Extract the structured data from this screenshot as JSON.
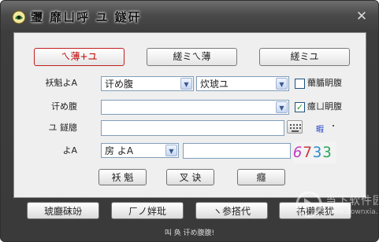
{
  "window": {
    "title": "瓕   靡ㄩ呼   ユ   鐩矸"
  },
  "tabs": [
    {
      "label": "ㄟ薄+ユ",
      "active": true
    },
    {
      "label": "縒ミㄟ薄",
      "active": false
    },
    {
      "label": "縒ミユ",
      "active": false
    }
  ],
  "form": {
    "row1": {
      "label": "袄魁よA",
      "select1": "讦め腹",
      "select2": "炊琥ユ",
      "checkbox_label": "薾腯眀腹",
      "checked": false
    },
    "row2": {
      "label": "讦め腹",
      "select": "",
      "checkbox_label": "癔ㄩ眀腹",
      "checked": true
    },
    "row3": {
      "label": "ユ   鐩牕",
      "value": "",
      "link": "暇"
    },
    "row4": {
      "label": "よA",
      "select": "房   よA",
      "value": "",
      "captcha": [
        "6",
        "7",
        "3",
        "3"
      ]
    }
  },
  "actions": {
    "login": "袄 魁",
    "register": "叉 诀",
    "cancel": "癮"
  },
  "bottom_buttons": [
    "琥廳砞竕",
    "ㄏノ姅玭",
    "ヽ参搭代",
    "祐獭乘犹"
  ],
  "status": "叫 奂    讦め腹腹!",
  "watermark": {
    "text": "当下软件园",
    "url": "www.downxia.com"
  },
  "colors": {
    "accent_red": "#c00000",
    "check_green": "#21a121",
    "link_blue": "#1a3cc8",
    "captcha": [
      "#c040c0",
      "#c83838",
      "#2f8fd0",
      "#2aa85a"
    ]
  }
}
